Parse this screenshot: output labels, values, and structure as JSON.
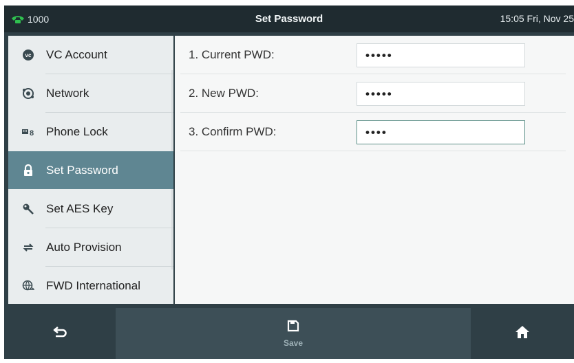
{
  "status": {
    "line": "1000",
    "title": "Set Password",
    "time": "15:05 Fri, Nov 25"
  },
  "sidebar": {
    "items": [
      {
        "label": "VC Account",
        "icon": "vc-account-icon"
      },
      {
        "label": "Network",
        "icon": "network-globe-icon"
      },
      {
        "label": "Phone Lock",
        "icon": "phone-lock-icon"
      },
      {
        "label": "Set Password",
        "icon": "lock-icon",
        "active": true
      },
      {
        "label": "Set AES Key",
        "icon": "key-icon"
      },
      {
        "label": "Auto Provision",
        "icon": "sync-arrows-icon"
      },
      {
        "label": "FWD International",
        "icon": "globe-forward-icon"
      }
    ]
  },
  "form": {
    "current_label": "1. Current PWD:",
    "current_value": "•••••",
    "new_label": "2. New PWD:",
    "new_value": "•••••",
    "confirm_label": "3. Confirm PWD:",
    "confirm_value": "••••"
  },
  "toolbar": {
    "back_icon": "back-arrow-icon",
    "save_label": "Save",
    "save_icon": "save-floppy-icon",
    "home_icon": "home-icon"
  },
  "colors": {
    "active_item": "#5f8692",
    "status_bar": "#1f2b30",
    "toolbar": "#2f3f46",
    "handset_green": "#2fbf4f"
  }
}
